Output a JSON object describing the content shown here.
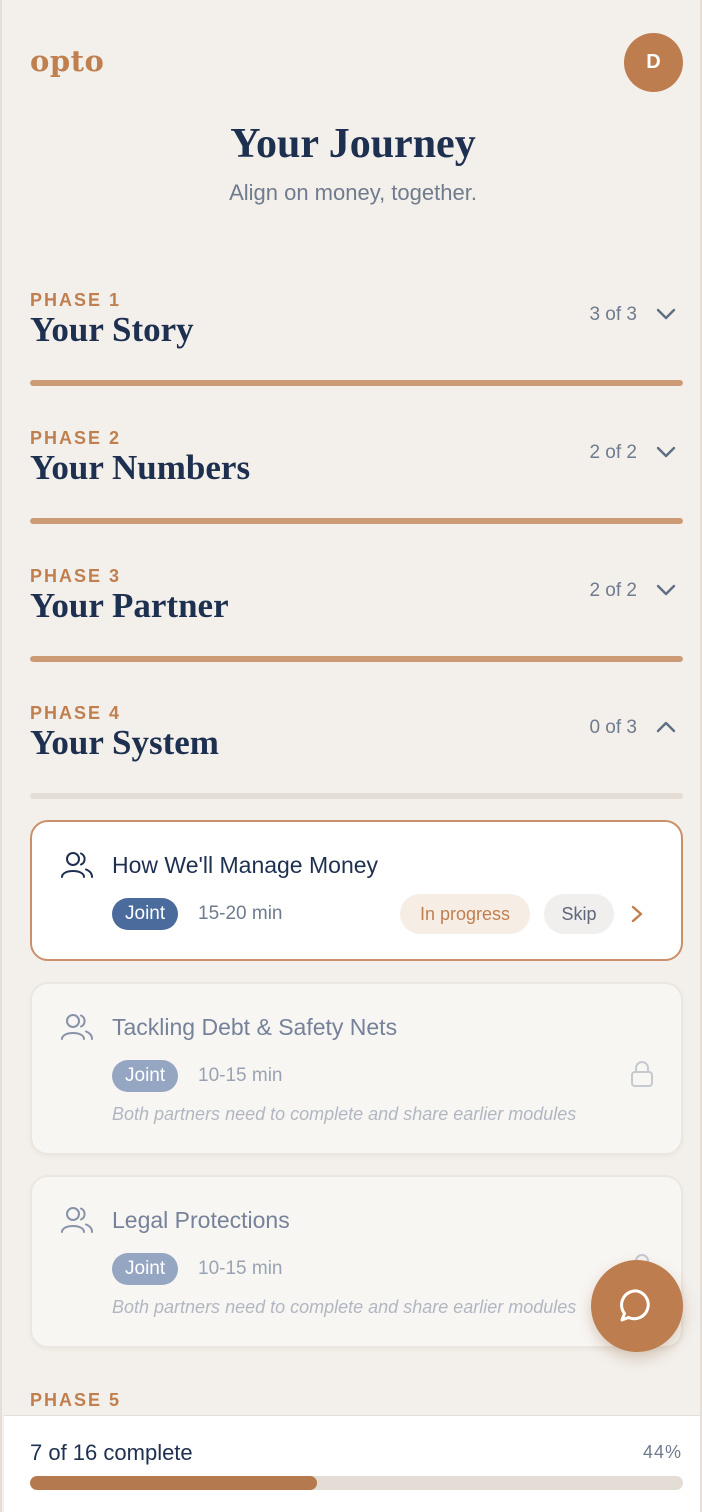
{
  "app": {
    "logo": "opto",
    "avatar_initial": "D"
  },
  "header": {
    "title": "Your Journey",
    "subtitle": "Align on money, together."
  },
  "phases": [
    {
      "label": "PHASE 1",
      "name": "Your Story",
      "count": "3 of 3",
      "progress": 1.0,
      "expanded": false
    },
    {
      "label": "PHASE 2",
      "name": "Your Numbers",
      "count": "2 of 2",
      "progress": 1.0,
      "expanded": false
    },
    {
      "label": "PHASE 3",
      "name": "Your Partner",
      "count": "2 of 2",
      "progress": 1.0,
      "expanded": false
    },
    {
      "label": "PHASE 4",
      "name": "Your System",
      "count": "0 of 3",
      "progress": 0.0,
      "expanded": true
    },
    {
      "label": "PHASE 5"
    }
  ],
  "modules": [
    {
      "name": "How We'll Manage Money",
      "tag": "Joint",
      "duration": "15-20 min",
      "status": "In progress",
      "skip": "Skip",
      "state": "active",
      "icon": "people-icon"
    },
    {
      "name": "Tackling Debt & Safety Nets",
      "tag": "Joint",
      "duration": "10-15 min",
      "note": "Both partners need to complete and share earlier modules",
      "state": "locked",
      "icon": "people-icon"
    },
    {
      "name": "Legal Protections",
      "tag": "Joint",
      "duration": "10-15 min",
      "note": "Both partners need to complete and share earlier modules",
      "state": "locked",
      "icon": "people-icon"
    }
  ],
  "footer": {
    "complete_text": "7 of 16 complete",
    "percent": "44%",
    "progress": 0.44
  },
  "colors": {
    "accent": "#c07f4f",
    "navy": "#1e3050",
    "joint_tag": "#4b6b9c",
    "background": "#f3efea"
  }
}
